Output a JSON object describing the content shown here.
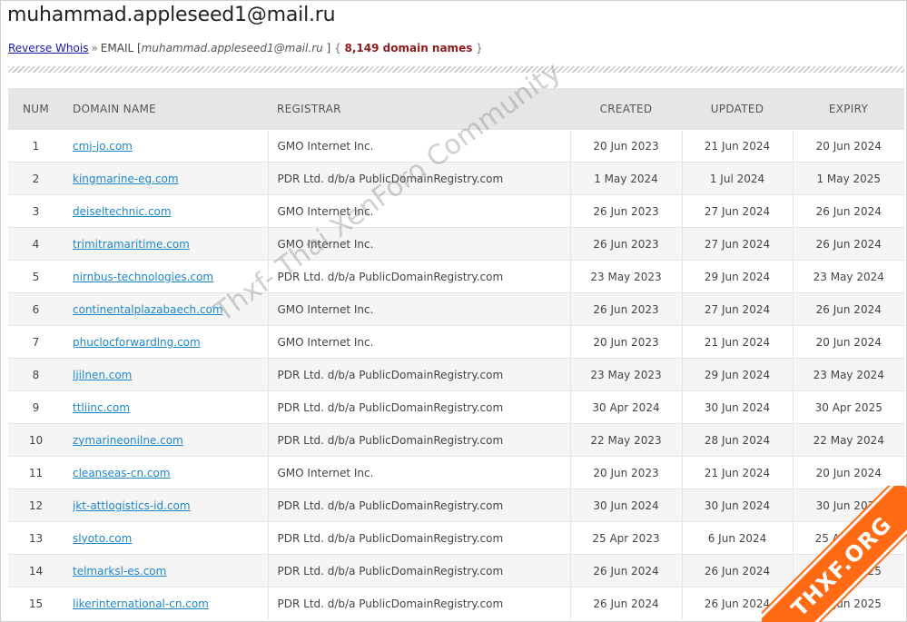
{
  "header": {
    "title": "muhammad.appleseed1@mail.ru",
    "breadcrumb_link": "Reverse Whois",
    "breadcrumb_sep": "»",
    "label_email": "EMAIL [",
    "email_italic": "muhammad.appleseed1@mail.ru",
    "label_close": " ]",
    "count_open": "{ ",
    "count": "8,149 domain names",
    "count_close": " }"
  },
  "table": {
    "columns": {
      "num": "NUM",
      "domain": "DOMAIN NAME",
      "registrar": "REGISTRAR",
      "created": "CREATED",
      "updated": "UPDATED",
      "expiry": "EXPIRY"
    },
    "rows": [
      {
        "num": "1",
        "domain": "cmj-jo.com",
        "registrar": "GMO Internet Inc.",
        "created": "20 Jun 2023",
        "updated": "21 Jun 2024",
        "expiry": "20 Jun 2024"
      },
      {
        "num": "2",
        "domain": "kingmarine-eg.com",
        "registrar": "PDR Ltd. d/b/a PublicDomainRegistry.com",
        "created": "1 May 2024",
        "updated": "1 Jul 2024",
        "expiry": "1 May 2025"
      },
      {
        "num": "3",
        "domain": "deiseltechnic.com",
        "registrar": "GMO Internet Inc.",
        "created": "26 Jun 2023",
        "updated": "27 Jun 2024",
        "expiry": "26 Jun 2024"
      },
      {
        "num": "4",
        "domain": "trimitramaritime.com",
        "registrar": "GMO Internet Inc.",
        "created": "26 Jun 2023",
        "updated": "27 Jun 2024",
        "expiry": "26 Jun 2024"
      },
      {
        "num": "5",
        "domain": "nirnbus-technologies.com",
        "registrar": "PDR Ltd. d/b/a PublicDomainRegistry.com",
        "created": "23 May 2023",
        "updated": "29 Jun 2024",
        "expiry": "23 May 2024"
      },
      {
        "num": "6",
        "domain": "continentalplazabaech.com",
        "registrar": "GMO Internet Inc.",
        "created": "26 Jun 2023",
        "updated": "27 Jun 2024",
        "expiry": "26 Jun 2024"
      },
      {
        "num": "7",
        "domain": "phuclocforwardlng.com",
        "registrar": "GMO Internet Inc.",
        "created": "20 Jun 2023",
        "updated": "21 Jun 2024",
        "expiry": "20 Jun 2024"
      },
      {
        "num": "8",
        "domain": "ljilnen.com",
        "registrar": "PDR Ltd. d/b/a PublicDomainRegistry.com",
        "created": "23 May 2023",
        "updated": "29 Jun 2024",
        "expiry": "23 May 2024"
      },
      {
        "num": "9",
        "domain": "ttliinc.com",
        "registrar": "PDR Ltd. d/b/a PublicDomainRegistry.com",
        "created": "30 Apr 2024",
        "updated": "30 Jun 2024",
        "expiry": "30 Apr 2025"
      },
      {
        "num": "10",
        "domain": "zymarineonilne.com",
        "registrar": "PDR Ltd. d/b/a PublicDomainRegistry.com",
        "created": "22 May 2023",
        "updated": "28 Jun 2024",
        "expiry": "22 May 2024"
      },
      {
        "num": "11",
        "domain": "cleanseas-cn.com",
        "registrar": "GMO Internet Inc.",
        "created": "20 Jun 2023",
        "updated": "21 Jun 2024",
        "expiry": "20 Jun 2024"
      },
      {
        "num": "12",
        "domain": "jkt-attlogistics-id.com",
        "registrar": "PDR Ltd. d/b/a PublicDomainRegistry.com",
        "created": "30 Jun 2024",
        "updated": "30 Jun 2024",
        "expiry": "30 Jun 2025"
      },
      {
        "num": "13",
        "domain": "slyoto.com",
        "registrar": "PDR Ltd. d/b/a PublicDomainRegistry.com",
        "created": "25 Apr 2023",
        "updated": "6 Jun 2024",
        "expiry": "25 Apr 2024"
      },
      {
        "num": "14",
        "domain": "telmarksl-es.com",
        "registrar": "PDR Ltd. d/b/a PublicDomainRegistry.com",
        "created": "26 Jun 2024",
        "updated": "26 Jun 2024",
        "expiry": "26 Jun 2025"
      },
      {
        "num": "15",
        "domain": "likerinternational-cn.com",
        "registrar": "PDR Ltd. d/b/a PublicDomainRegistry.com",
        "created": "26 Jun 2024",
        "updated": "26 Jun 2024",
        "expiry": "26 Jun 2025"
      }
    ]
  },
  "overlay": {
    "watermark": "Thxf- Thai XenForo Community",
    "badge": "THXF.ORG",
    "badge_color": "#ff6a13"
  }
}
